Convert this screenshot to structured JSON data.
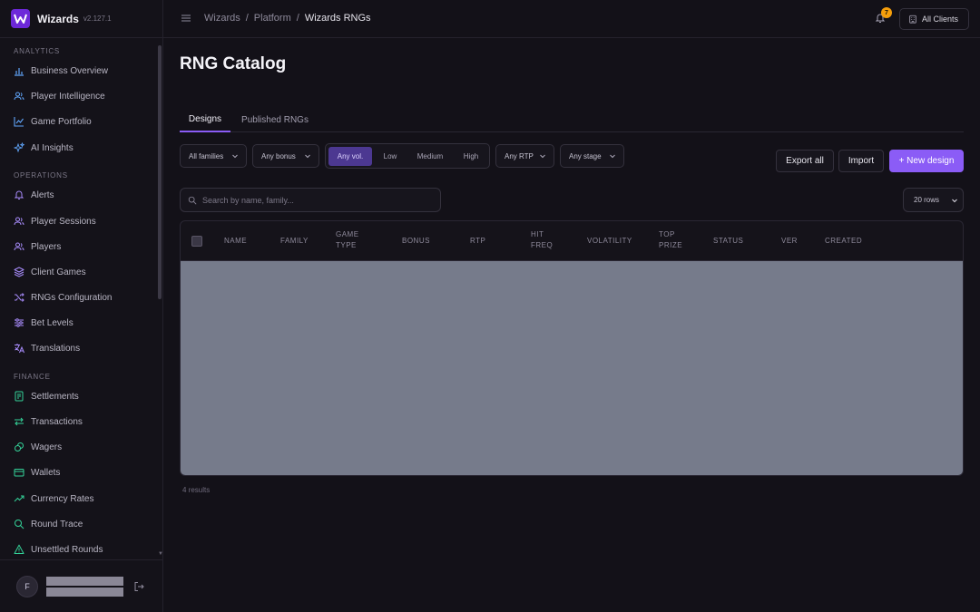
{
  "app": {
    "name": "Wizards",
    "version": "v2.127.1",
    "logo_letter": "W"
  },
  "sidebar": {
    "sections": [
      {
        "label": "ANALYTICS",
        "items": [
          {
            "label": "Business Overview",
            "icon": "bar-chart-icon",
            "color": "#60a5fa"
          },
          {
            "label": "Player Intelligence",
            "icon": "users-icon",
            "color": "#60a5fa"
          },
          {
            "label": "Game Portfolio",
            "icon": "line-chart-icon",
            "color": "#60a5fa"
          },
          {
            "label": "AI Insights",
            "icon": "sparkles-icon",
            "color": "#60a5fa"
          }
        ]
      },
      {
        "label": "OPERATIONS",
        "items": [
          {
            "label": "Alerts",
            "icon": "bell-icon",
            "color": "#a78bfa"
          },
          {
            "label": "Player Sessions",
            "icon": "users-icon",
            "color": "#a78bfa"
          },
          {
            "label": "Players",
            "icon": "users-icon",
            "color": "#a78bfa"
          },
          {
            "label": "Client Games",
            "icon": "layers-icon",
            "color": "#a78bfa"
          },
          {
            "label": "RNGs Configuration",
            "icon": "shuffle-icon",
            "color": "#a78bfa"
          },
          {
            "label": "Bet Levels",
            "icon": "sliders-icon",
            "color": "#a78bfa"
          },
          {
            "label": "Translations",
            "icon": "languages-icon",
            "color": "#a78bfa"
          }
        ]
      },
      {
        "label": "FINANCE",
        "items": [
          {
            "label": "Settlements",
            "icon": "receipt-icon",
            "color": "#34d399"
          },
          {
            "label": "Transactions",
            "icon": "arrows-icon",
            "color": "#34d399"
          },
          {
            "label": "Wagers",
            "icon": "coins-icon",
            "color": "#34d399"
          },
          {
            "label": "Wallets",
            "icon": "wallet-icon",
            "color": "#34d399"
          },
          {
            "label": "Currency Rates",
            "icon": "trending-up-icon",
            "color": "#34d399"
          },
          {
            "label": "Round Trace",
            "icon": "search-icon",
            "color": "#34d399"
          },
          {
            "label": "Unsettled Rounds",
            "icon": "warning-icon",
            "color": "#34d399"
          }
        ]
      }
    ],
    "user": {
      "initial": "F"
    }
  },
  "topbar": {
    "breadcrumbs": [
      "Wizards",
      "Platform",
      "Wizards RNGs"
    ],
    "notification_count": "7",
    "clients_label": "All Clients"
  },
  "page": {
    "title": "RNG Catalog",
    "tabs": [
      "Designs",
      "Published RNGs"
    ],
    "active_tab": "Designs",
    "filters": {
      "family": "All families",
      "bonus": "Any bonus",
      "volatility_options": [
        "Any vol.",
        "Low",
        "Medium",
        "High"
      ],
      "volatility_selected": "Any vol.",
      "rtp": "Any RTP",
      "stage": "Any stage"
    },
    "actions": {
      "export": "Export all",
      "import": "Import",
      "new": "+ New design"
    },
    "search_placeholder": "Search by name, family...",
    "rows_per_page": "20 rows",
    "table": {
      "columns": [
        "NAME",
        "FAMILY",
        "GAME\nTYPE",
        "BONUS",
        "RTP",
        "HIT\nFREQ",
        "VOLATILITY",
        "TOP\nPRIZE",
        "STATUS",
        "VER",
        "CREATED"
      ]
    },
    "results": "4 results"
  },
  "colors": {
    "accent": "#8b5cf6",
    "badge": "#f59e0b",
    "background": "#131118"
  }
}
